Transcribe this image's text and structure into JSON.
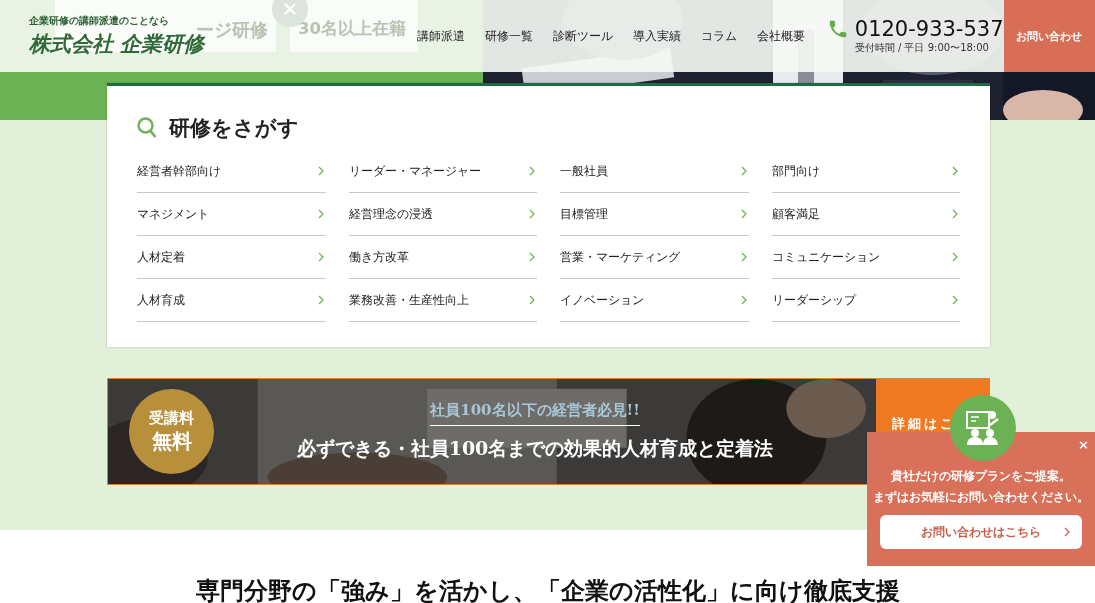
{
  "header": {
    "tagline": "企業研修の講師派遣のことなら",
    "logo": "株式会社 企業研修",
    "nav": [
      "講師派遣",
      "研修一覧",
      "診断ツール",
      "導入実績",
      "コラム",
      "会社概要"
    ],
    "phone": "0120-933-537",
    "hours": "受付時間 / 平日 9:00〜18:00",
    "contact_button": "お問い合わせ"
  },
  "hero_badges": [
    "ージ研修",
    "30名以上在籍"
  ],
  "search": {
    "title": "研修をさがす",
    "categories": [
      "経営者幹部向け",
      "リーダー・マネージャー",
      "一般社員",
      "部門向け",
      "マネジメント",
      "経営理念の浸透",
      "目標管理",
      "顧客満足",
      "人材定着",
      "働き方改革",
      "営業・マーケティング",
      "コミュニケーション",
      "人材育成",
      "業務改善・生産性向上",
      "イノベーション",
      "リーダーシップ"
    ]
  },
  "banner": {
    "badge": [
      "受講料",
      "無料"
    ],
    "subtitle": "社員100名以下の経営者必見!!",
    "title": "必ずできる・社員100名までの効果的人材育成と定着法",
    "link": "詳細はこ"
  },
  "popup": {
    "close": "×",
    "lines": [
      "貴社だけの研修プランをご提案。",
      "まずはお気軽にお問い合わせください。"
    ],
    "button": "お問い合わせはこちら"
  },
  "heading": "専門分野の「強み」を活かし、「企業の活性化」に向け徹底支援"
}
